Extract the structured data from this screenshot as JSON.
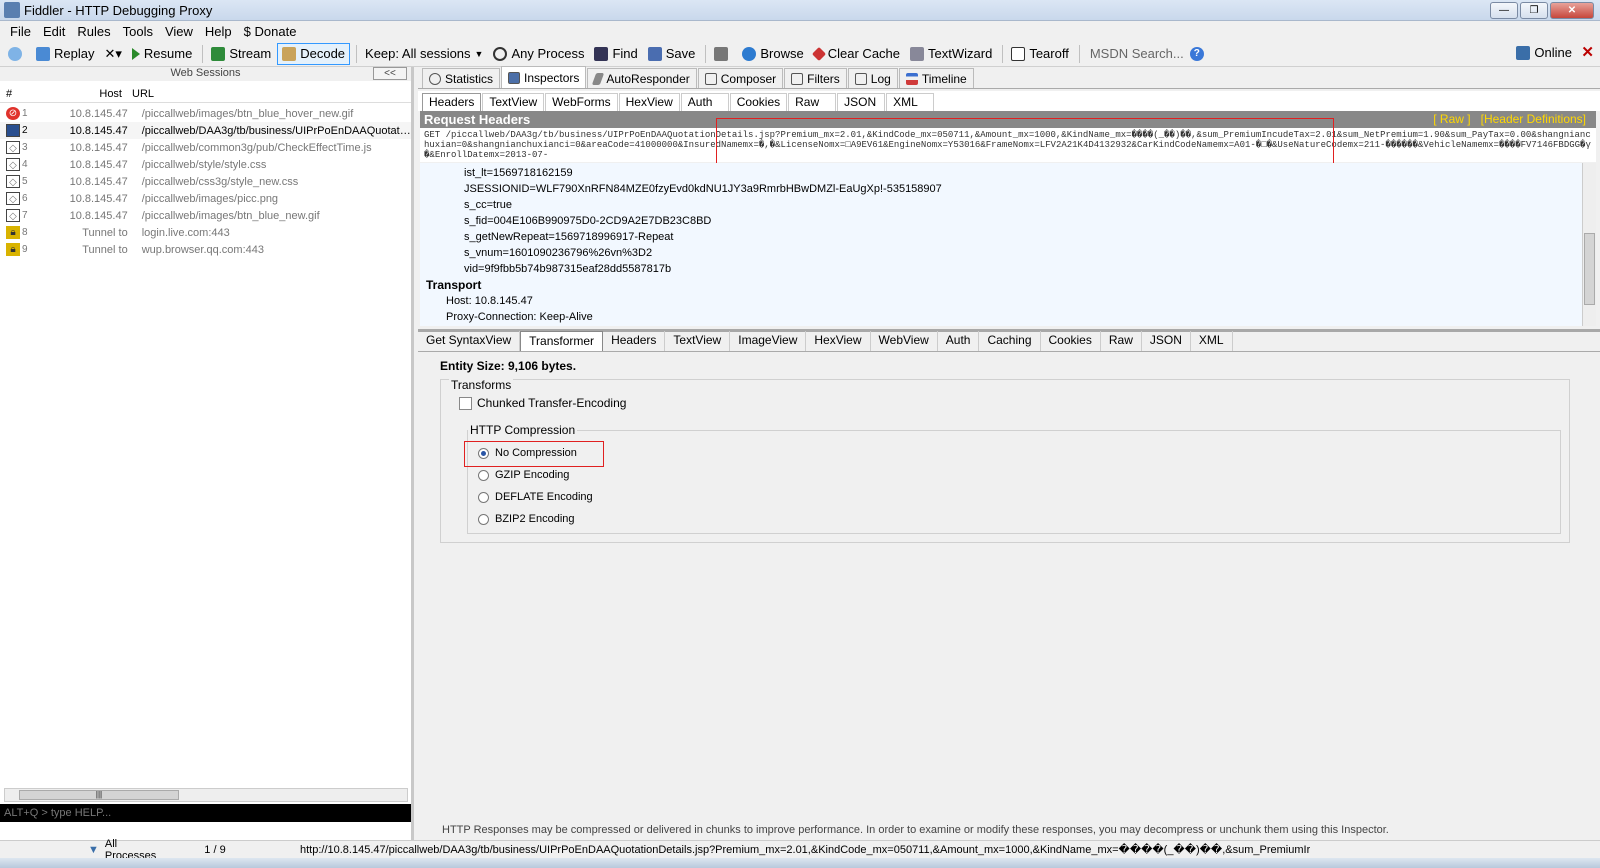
{
  "window": {
    "title": "Fiddler - HTTP Debugging Proxy"
  },
  "menu": [
    "File",
    "Edit",
    "Rules",
    "Tools",
    "View",
    "Help",
    "$ Donate"
  ],
  "toolbar": {
    "replay": "Replay",
    "remove": "✕▾",
    "resume": "Resume",
    "stream": "Stream",
    "decode": "Decode",
    "keep": "Keep: All sessions",
    "process": "Any Process",
    "find": "Find",
    "save": "Save",
    "browse": "Browse",
    "clear_cache": "Clear Cache",
    "textwizard": "TextWizard",
    "tearoff": "Tearoff",
    "msdn": "MSDN Search...",
    "online": "Online"
  },
  "sessions": {
    "header": "Web Sessions",
    "collapse": "<<",
    "columns": {
      "num": "#",
      "host": "Host",
      "url": "URL"
    },
    "rows": [
      {
        "n": "1",
        "host": "10.8.145.47",
        "url": "/piccallweb/images/btn_blue_hover_new.gif",
        "icon": "error"
      },
      {
        "n": "2",
        "host": "10.8.145.47",
        "url": "/piccallweb/DAA3g/tb/business/UIPrPoEnDAAQuotati...",
        "icon": "selected"
      },
      {
        "n": "3",
        "host": "10.8.145.47",
        "url": "/piccallweb/common3g/pub/CheckEffectTime.js",
        "icon": "response"
      },
      {
        "n": "4",
        "host": "10.8.145.47",
        "url": "/piccallweb/style/style.css",
        "icon": "response"
      },
      {
        "n": "5",
        "host": "10.8.145.47",
        "url": "/piccallweb/css3g/style_new.css",
        "icon": "response"
      },
      {
        "n": "6",
        "host": "10.8.145.47",
        "url": "/piccallweb/images/picc.png",
        "icon": "response"
      },
      {
        "n": "7",
        "host": "10.8.145.47",
        "url": "/piccallweb/images/btn_blue_new.gif",
        "icon": "response"
      },
      {
        "n": "8",
        "host": "Tunnel to",
        "url": "login.live.com:443",
        "icon": "lock"
      },
      {
        "n": "9",
        "host": "Tunnel to",
        "url": "wup.browser.qq.com:443",
        "icon": "lock"
      }
    ],
    "quickexec": "ALT+Q > type HELP..."
  },
  "main_tabs": [
    "Statistics",
    "Inspectors",
    "AutoResponder",
    "Composer",
    "Filters",
    "Log",
    "Timeline"
  ],
  "request_tabs": [
    "Headers",
    "TextView",
    "WebForms",
    "HexView",
    "Auth",
    "Cookies",
    "Raw",
    "JSON",
    "XML"
  ],
  "request": {
    "section": "Request Headers",
    "raw_link": "[ Raw ]",
    "defs_link": "[Header Definitions]",
    "line": "GET /piccallweb/DAA3g/tb/business/UIPrPoEnDAAQuotationDetails.jsp?Premium_mx=2.01,&KindCode_mx=050711,&Amount_mx=1000,&KindName_mx=����(_��)��,&sum_PremiumIncudeTax=2.01&sum_NetPremium=1.90&sum_PayTax=0.00&shangnianchuxian=0&shangnianchuxianci=0&areaCode=41000000&InsuredNamemx=�,�&LicenseNomx=□A9EV61&EngineNomx=Y53016&FrameNomx=LFV2A21K4D4132932&CarKindCodeNamemx=A01-�□�&UseNatureCodemx=211-������&VehicleNamemx=����FV7146FBDGG�γ�&EnrollDatemx=2013-07-",
    "cookies": [
      "ist_lt=1569718162159",
      "JSESSIONID=WLF790XnRFN84MZE0fzyEvd0kdNU1JY3a9RmrbHBwDMZl-EaUgXp!-535158907",
      "s_cc=true",
      "s_fid=004E106B990975D0-2CD9A2E7DB23C8BD",
      "s_getNewRepeat=1569718996917-Repeat",
      "s_vnum=1601090236796%26vn%3D2",
      "vid=9f9fbb5b74b987315eaf28dd5587817b"
    ],
    "transport_label": "Transport",
    "host": "Host: 10.8.145.47",
    "proxy": "Proxy-Connection: Keep-Alive"
  },
  "response_tabs": [
    "Get SyntaxView",
    "Transformer",
    "Headers",
    "TextView",
    "ImageView",
    "HexView",
    "WebView",
    "Auth",
    "Caching",
    "Cookies",
    "Raw",
    "JSON",
    "XML"
  ],
  "transformer": {
    "entity_size": "Entity Size: 9,106 bytes.",
    "transforms_label": "Transforms",
    "chunked_label": "Chunked Transfer-Encoding",
    "compression_label": "HTTP Compression",
    "options": [
      "No Compression",
      "GZIP Encoding",
      "DEFLATE Encoding",
      "BZIP2 Encoding"
    ],
    "selected": "No Compression",
    "footnote": "HTTP Responses may be compressed or delivered in chunks to improve performance.  In order to examine or modify these responses, you may decompress or unchunk them using this Inspector."
  },
  "status": {
    "processes": "All Processes",
    "count": "1 / 9",
    "url": "http://10.8.145.47/piccallweb/DAA3g/tb/business/UIPrPoEnDAAQuotationDetails.jsp?Premium_mx=2.01,&KindCode_mx=050711,&Amount_mx=1000,&KindName_mx=����(_��)��,&sum_PremiumIr"
  },
  "colors": {
    "accent": "#3399ff",
    "highlight_box": "#e02020",
    "header_bar": "#888888",
    "link_yellow": "#ffd800"
  }
}
